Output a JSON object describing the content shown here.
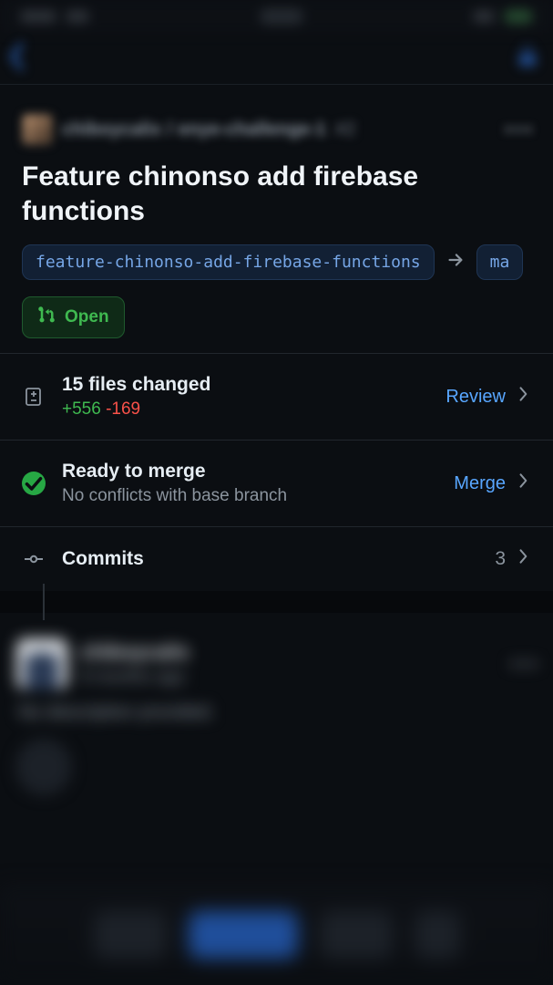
{
  "breadcrumb": {
    "owner": "chiboycalix",
    "repo": "enye-challenge-1",
    "pr_number": "#2"
  },
  "title": "Feature chinonso add firebase functions",
  "branches": {
    "source": "feature-chinonso-add-firebase-functions",
    "target": "ma"
  },
  "status": {
    "label": "Open"
  },
  "files_changed": {
    "title": "15 files changed",
    "additions": "+556",
    "deletions": "-169",
    "action": "Review"
  },
  "merge": {
    "title": "Ready to merge",
    "subtitle": "No conflicts with base branch",
    "action": "Merge"
  },
  "commits": {
    "title": "Commits",
    "count": "3"
  },
  "timeline": {
    "author": "chiboycalix",
    "time": "9 months ago",
    "body": "No description provided."
  }
}
